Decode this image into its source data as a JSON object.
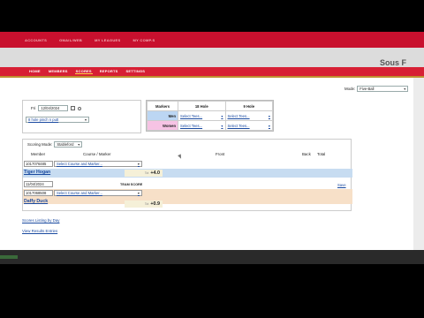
{
  "top_nav": {
    "left_text": "",
    "items": [
      "ACCOUNTS",
      "GMAIL/WEB",
      "MY LEAGUES",
      "MY COMP.S"
    ]
  },
  "brand_partial": "Sous F",
  "sub_nav": {
    "items": [
      "HOME",
      "MEMBERS",
      "SCORES",
      "REPORTS",
      "SETTINGS"
    ],
    "active": "SCORES"
  },
  "mode": {
    "label": "Mode:",
    "value": "Five-Ball"
  },
  "date": {
    "label": "Fri",
    "value": "12/04/2024"
  },
  "holes_select": "8 hole pinch n putt",
  "markers": {
    "headers": [
      "Markers",
      "18 Hole",
      "9 Hole"
    ],
    "rows": [
      {
        "label": "Men",
        "tee18": "Select Tees...",
        "tee9": "Select Tees..."
      },
      {
        "label": "Women",
        "tee18": "Select Tees...",
        "tee9": "Select Tees..."
      }
    ]
  },
  "scoring": {
    "label": "Scoring Mode:",
    "value": "Stableford"
  },
  "columns": {
    "member": "Member",
    "course": "Course / Marker",
    "front": "Front",
    "back": "Back",
    "total": "Total"
  },
  "rows": [
    {
      "id": "1017076485",
      "course": "Select Course and Marker...",
      "name": "Tiger Hogan",
      "tot_label": "Tot",
      "score": "+4.0"
    },
    {
      "id": "1017068508",
      "course": "Select Course and Marker...",
      "name": "Daffy Duck",
      "tot_label": "Tot",
      "score": "+0.9"
    }
  ],
  "team": {
    "date": "11/04/2024",
    "label": "TEAM SCORE",
    "save": "Save"
  },
  "links": [
    "Scores Listing by Day",
    "View Results Entries"
  ],
  "colors": {
    "red": "#c8102e",
    "men": "#bcd6f3",
    "women": "#f6c3e4",
    "row1": "#c7dcf1",
    "row2": "#f7e0c8",
    "link": "#1a4aa0"
  }
}
